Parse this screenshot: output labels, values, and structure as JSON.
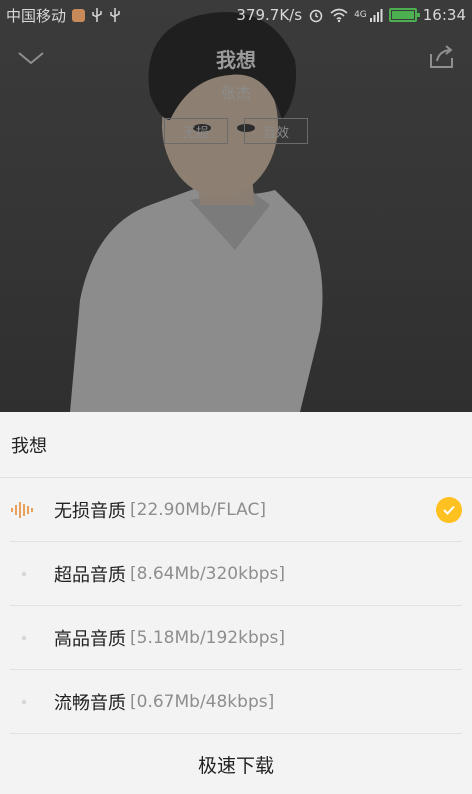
{
  "status_bar": {
    "carrier": "中国移动",
    "speed": "379.7K/s",
    "network": "4G",
    "time": "16:34",
    "battery_level": 1.0
  },
  "header": {
    "song_title": "我想",
    "artist": "张杰",
    "chips": [
      "无损",
      "音效"
    ]
  },
  "sheet": {
    "title": "我想",
    "options": [
      {
        "label": "无损音质",
        "info": "[22.90Mb/FLAC]",
        "selected": true
      },
      {
        "label": "超品音质",
        "info": "[8.64Mb/320kbps]",
        "selected": false
      },
      {
        "label": "高品音质",
        "info": "[5.18Mb/192kbps]",
        "selected": false
      },
      {
        "label": "流畅音质",
        "info": "[0.67Mb/48kbps]",
        "selected": false
      }
    ],
    "fast_download": "极速下载"
  },
  "colors": {
    "accent": "#ffc11f",
    "wave": "#e8a05a",
    "battery": "#4caf50"
  }
}
